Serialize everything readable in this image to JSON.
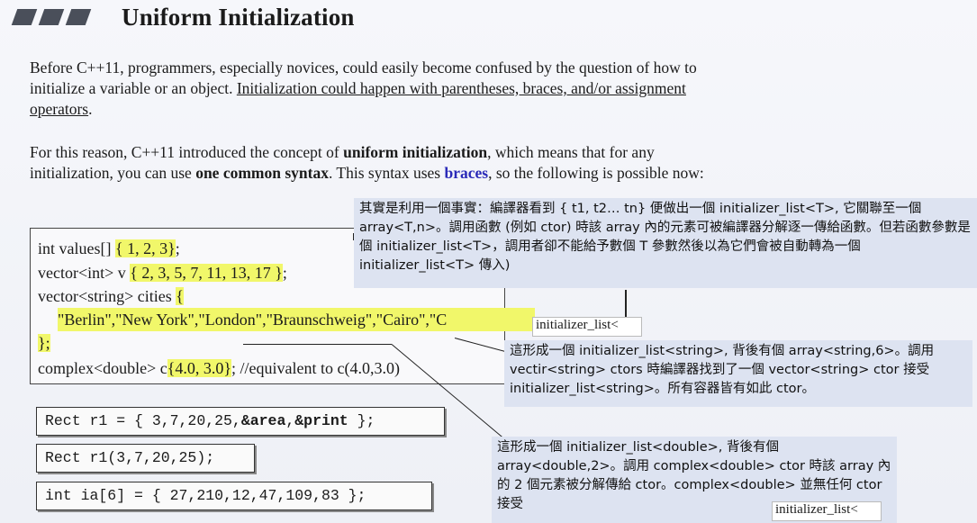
{
  "slide": {
    "title": "Uniform Initialization",
    "p1_a": "Before C++11, programmers, especially novices, could easily become confused by the question of how to initialize a variable or an object. ",
    "p1_u": "Initialization could happen with parentheses, braces, and/or assignment operators",
    "p1_end": ".",
    "p2_a": "For this reason, C++11 introduced the concept of ",
    "p2_b": "uniform initialization",
    "p2_c": ", which means that for any initialization, you can use ",
    "p2_d": "one common syntax",
    "p2_e": ". This syntax uses ",
    "p2_f": "braces",
    "p2_g": ",  so the following is possible now:"
  },
  "code": {
    "l1a": "int values[] ",
    "l1b": "{ 1, 2, 3}",
    "l1c": ";",
    "l2a": "vector<int> v ",
    "l2b": "{ 2, 3, 5, 7, 11, 13, 17 }",
    "l2c": ";",
    "l3a": "vector<string> cities ",
    "l3b": "{",
    "l4": "\"Berlin\",\"New York\",\"London\",\"Braunschweig\",\"Cairo\",\"C",
    "l5": "};",
    "l6a": "complex<double> c",
    "l6b": "{4.0, 3.0}",
    "l6c": ";  //equivalent to c(4.0,3.0)"
  },
  "boxes": {
    "b1a": "Rect r1 = { 3,7,20,25,",
    "b1b": "&area",
    "b1c": ",",
    "b1d": "&print",
    "b1e": " };",
    "b2": "Rect r1(3,7,20,25);",
    "b3": "int ia[6] = { 27,210,12,47,109,83 };"
  },
  "notes": {
    "n1": "其實是利用一個事實：編譯器看到 { t1, t2… tn} 便做出一個 initializer_list<T>, 它關聯至一個 array<T,n>。調用函數 (例如 ctor) 時該 array 內的元素可被編譯器分解逐一傳給函數。但若函數參數是個 initializer_list<T>，調用者卻不能給予數個 T 參數然後以為它們會被自動轉為一個 initializer_list<T> 傳入)",
    "n2": "這形成一個 initializer_list<string>, 背後有個 array<string,6>。調用 vectir<string> ctors 時編譯器找到了一個 vector<string> ctor 接受 initializer_list<string>。所有容器皆有如此 ctor。",
    "n3": "這形成一個 initializer_list<double>, 背後有個 array<double,2>。調用 complex<double> ctor 時該 array 內的 2 個元素被分解傳給 ctor。complex<double> 並無任何 ctor 接受",
    "tag1": "initializer_list<",
    "tag2": "initializer_list<"
  }
}
